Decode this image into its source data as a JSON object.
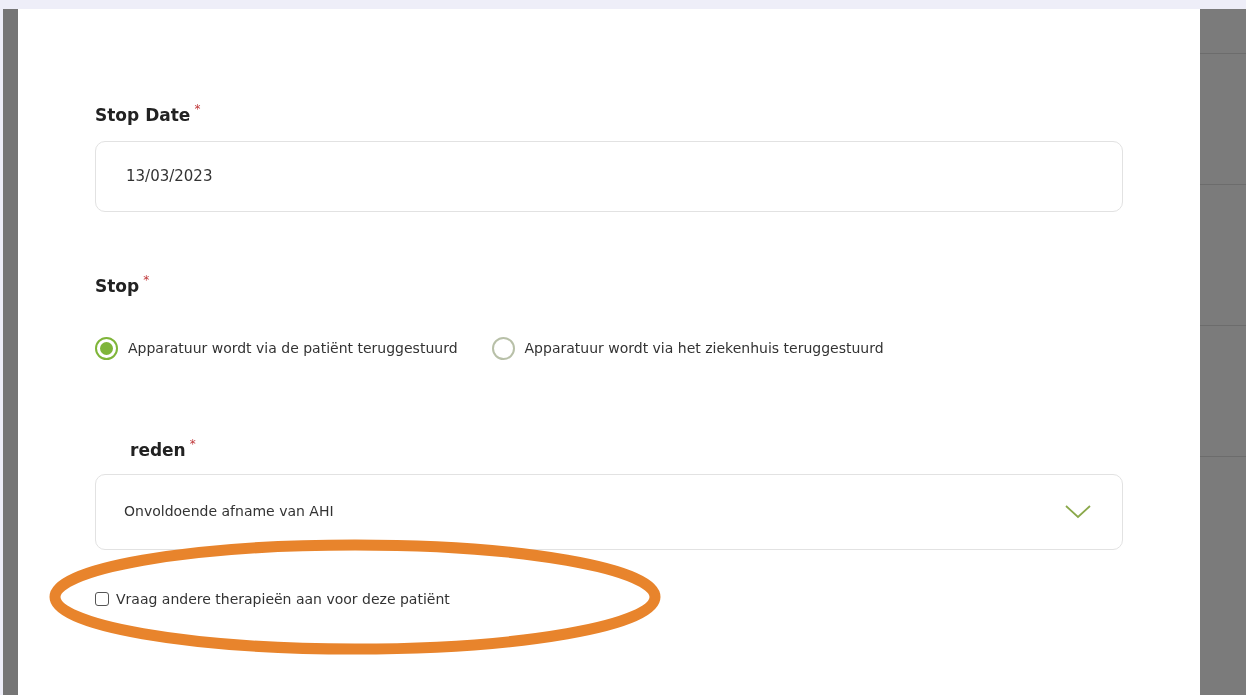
{
  "stop_date": {
    "label": "Stop Date",
    "required_mark": "*",
    "value": "13/03/2023"
  },
  "stop": {
    "label": "Stop",
    "required_mark": "*",
    "options": [
      {
        "label": "Apparatuur wordt via de patiënt teruggestuurd",
        "selected": true
      },
      {
        "label": "Apparatuur wordt via het ziekenhuis teruggestuurd",
        "selected": false
      }
    ]
  },
  "reason": {
    "label": "reden",
    "required_mark": "*",
    "value": "Onvoldoende afname van AHI"
  },
  "other_therapies": {
    "label": "Vraag andere therapieën aan voor deze patiënt",
    "checked": false
  },
  "annotation": {
    "kind": "ellipse",
    "color": "#e8842c"
  }
}
